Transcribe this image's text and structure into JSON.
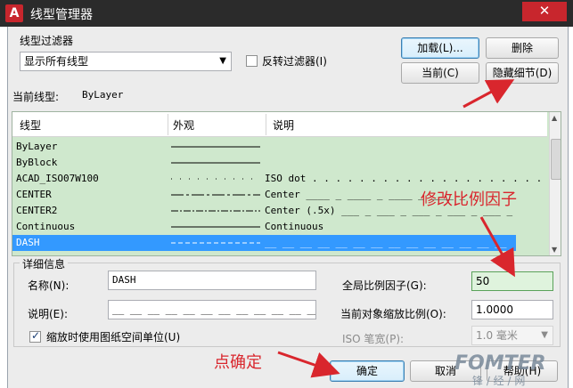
{
  "window": {
    "title": "线型管理器",
    "app_icon": "A",
    "close_glyph": "✕"
  },
  "filter": {
    "group_label": "线型过滤器",
    "selected": "显示所有线型",
    "invert_label": "反转过滤器(I)",
    "invert_checked": false
  },
  "buttons": {
    "load": "加载(L)...",
    "delete": "删除",
    "current": "当前(C)",
    "hide_details": "隐藏细节(D)",
    "ok": "确定",
    "cancel": "取消",
    "help": "帮助(H)"
  },
  "current_linetype": {
    "label": "当前线型:",
    "value": "ByLayer"
  },
  "table": {
    "columns": [
      "线型",
      "外观",
      "说明"
    ],
    "rows": [
      {
        "name": "ByLayer",
        "appearance": "solid",
        "description": ""
      },
      {
        "name": "ByBlock",
        "appearance": "solid",
        "description": ""
      },
      {
        "name": "ACAD_ISO07W100",
        "appearance": "dot",
        "description": "ISO dot . . . . . . . . . . . . . . . . . . . . ."
      },
      {
        "name": "CENTER",
        "appearance": "center",
        "description": "Center ____ _ ____ _ ____ _ ____ _"
      },
      {
        "name": "CENTER2",
        "appearance": "center",
        "description": "Center (.5x) ___ _ ___ _ ___ _ ___ _ ___ _"
      },
      {
        "name": "Continuous",
        "appearance": "solid",
        "description": "Continuous"
      },
      {
        "name": "DASH",
        "appearance": "dash",
        "description": "__ __ __ __ __ __ __ __ __ __ __ __ __ __",
        "selected": true
      }
    ]
  },
  "details": {
    "group_label": "详细信息",
    "name_label": "名称(N):",
    "name_value": "DASH",
    "desc_label": "说明(E):",
    "desc_value": "__ __ __ __ __ __ __ __ __ __ __ __ __ __ __",
    "paper_space_label": "缩放时使用图纸空间单位(U)",
    "paper_space_checked": true,
    "global_scale_label": "全局比例因子(G):",
    "global_scale_value": "50",
    "object_scale_label": "当前对象缩放比例(O):",
    "object_scale_value": "1.0000",
    "pen_width_label": "ISO 笔宽(P):",
    "pen_width_value": "1.0 毫米"
  },
  "annotations": {
    "modify_scale": "修改比例因子",
    "click_ok": "点确定",
    "color": "#d9262d"
  },
  "watermark": {
    "main": "FOMTER",
    "sub": "锋 / 经 / 网"
  }
}
